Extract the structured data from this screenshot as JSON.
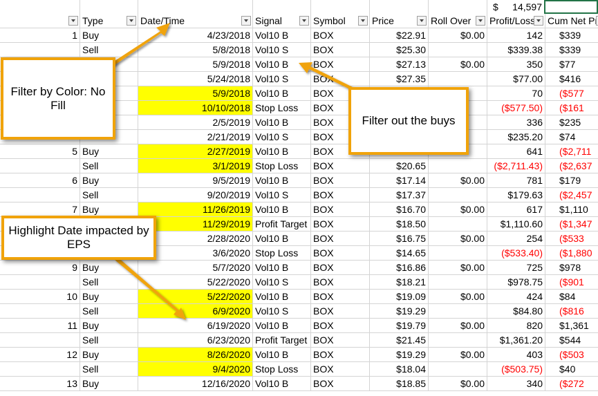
{
  "summary_cell": {
    "currency": "$",
    "value": "14,597"
  },
  "headers": [
    "Type",
    "Date/Time",
    "Signal",
    "Symbol",
    "Price",
    "Roll Over",
    "Profit/Loss",
    "Cum Net Pr"
  ],
  "rows": [
    {
      "num": "1",
      "type": "Buy",
      "date": "4/23/2018",
      "signal": "Vol10 B",
      "symbol": "BOX",
      "price": "$22.91",
      "roll": "$0.00",
      "pl": "142",
      "cum": "$339",
      "hl": false,
      "pl_neg": false,
      "cum_neg": false
    },
    {
      "num": "",
      "type": "Sell",
      "date": "5/8/2018",
      "signal": "Vol10 S",
      "symbol": "BOX",
      "price": "$25.30",
      "roll": "",
      "pl": "$339.38",
      "cum": "$339",
      "hl": false,
      "pl_neg": false,
      "cum_neg": false
    },
    {
      "num": "",
      "type": "",
      "date": "5/9/2018",
      "signal": "Vol10 B",
      "symbol": "BOX",
      "price": "$27.13",
      "roll": "$0.00",
      "pl": "350",
      "cum": "$77",
      "hl": false,
      "pl_neg": false,
      "cum_neg": false
    },
    {
      "num": "",
      "type": "",
      "date": "5/24/2018",
      "signal": "Vol10 S",
      "symbol": "BOX",
      "price": "$27.35",
      "roll": "",
      "pl": "$77.00",
      "cum": "$416",
      "hl": false,
      "pl_neg": false,
      "cum_neg": false
    },
    {
      "num": "",
      "type": "",
      "date": "5/9/2018",
      "signal": "Vol10 B",
      "symbol": "BOX",
      "price": "",
      "roll": "",
      "pl": "70",
      "cum": "($577",
      "hl": true,
      "pl_neg": false,
      "cum_neg": true
    },
    {
      "num": "",
      "type": "",
      "date": "10/10/2018",
      "signal": "Stop Loss",
      "symbol": "BOX",
      "price": "",
      "roll": "",
      "pl": "($577.50)",
      "cum": "($161",
      "hl": true,
      "pl_neg": true,
      "cum_neg": true
    },
    {
      "num": "",
      "type": "",
      "date": "2/5/2019",
      "signal": "Vol10 B",
      "symbol": "BOX",
      "price": "",
      "roll": "",
      "pl": "336",
      "cum": "$235",
      "hl": false,
      "pl_neg": false,
      "cum_neg": false
    },
    {
      "num": "",
      "type": "",
      "date": "2/21/2019",
      "signal": "Vol10 S",
      "symbol": "BOX",
      "price": "",
      "roll": "",
      "pl": "$235.20",
      "cum": "$74",
      "hl": false,
      "pl_neg": false,
      "cum_neg": false
    },
    {
      "num": "5",
      "type": "Buy",
      "date": "2/27/2019",
      "signal": "Vol10 B",
      "symbol": "BOX",
      "price": "",
      "roll": "",
      "pl": "641",
      "cum": "($2,711",
      "hl": true,
      "pl_neg": false,
      "cum_neg": true
    },
    {
      "num": "",
      "type": "Sell",
      "date": "3/1/2019",
      "signal": "Stop Loss",
      "symbol": "BOX",
      "price": "$20.65",
      "roll": "",
      "pl": "($2,711.43)",
      "cum": "($2,637",
      "hl": true,
      "pl_neg": true,
      "cum_neg": true
    },
    {
      "num": "6",
      "type": "Buy",
      "date": "9/5/2019",
      "signal": "Vol10 B",
      "symbol": "BOX",
      "price": "$17.14",
      "roll": "$0.00",
      "pl": "781",
      "cum": "$179",
      "hl": false,
      "pl_neg": false,
      "cum_neg": false
    },
    {
      "num": "",
      "type": "Sell",
      "date": "9/20/2019",
      "signal": "Vol10 S",
      "symbol": "BOX",
      "price": "$17.37",
      "roll": "",
      "pl": "$179.63",
      "cum": "($2,457",
      "hl": false,
      "pl_neg": false,
      "cum_neg": true
    },
    {
      "num": "7",
      "type": "Buy",
      "date": "11/26/2019",
      "signal": "Vol10 B",
      "symbol": "BOX",
      "price": "$16.70",
      "roll": "$0.00",
      "pl": "617",
      "cum": "$1,110",
      "hl": true,
      "pl_neg": false,
      "cum_neg": false
    },
    {
      "num": "",
      "type": "",
      "date": "11/29/2019",
      "signal": "Profit Target",
      "symbol": "BOX",
      "price": "$18.50",
      "roll": "",
      "pl": "$1,110.60",
      "cum": "($1,347",
      "hl": true,
      "pl_neg": false,
      "cum_neg": true
    },
    {
      "num": "",
      "type": "",
      "date": "2/28/2020",
      "signal": "Vol10 B",
      "symbol": "BOX",
      "price": "$16.75",
      "roll": "$0.00",
      "pl": "254",
      "cum": "($533",
      "hl": false,
      "pl_neg": false,
      "cum_neg": true
    },
    {
      "num": "",
      "type": "",
      "date": "3/6/2020",
      "signal": "Stop Loss",
      "symbol": "BOX",
      "price": "$14.65",
      "roll": "",
      "pl": "($533.40)",
      "cum": "($1,880",
      "hl": false,
      "pl_neg": true,
      "cum_neg": true
    },
    {
      "num": "9",
      "type": "Buy",
      "date": "5/7/2020",
      "signal": "Vol10 B",
      "symbol": "BOX",
      "price": "$16.86",
      "roll": "$0.00",
      "pl": "725",
      "cum": "$978",
      "hl": false,
      "pl_neg": false,
      "cum_neg": false
    },
    {
      "num": "",
      "type": "Sell",
      "date": "5/22/2020",
      "signal": "Vol10 S",
      "symbol": "BOX",
      "price": "$18.21",
      "roll": "",
      "pl": "$978.75",
      "cum": "($901",
      "hl": false,
      "pl_neg": false,
      "cum_neg": true
    },
    {
      "num": "10",
      "type": "Buy",
      "date": "5/22/2020",
      "signal": "Vol10 B",
      "symbol": "BOX",
      "price": "$19.09",
      "roll": "$0.00",
      "pl": "424",
      "cum": "$84",
      "hl": true,
      "pl_neg": false,
      "cum_neg": false
    },
    {
      "num": "",
      "type": "Sell",
      "date": "6/9/2020",
      "signal": "Vol10 S",
      "symbol": "BOX",
      "price": "$19.29",
      "roll": "",
      "pl": "$84.80",
      "cum": "($816",
      "hl": true,
      "pl_neg": false,
      "cum_neg": true
    },
    {
      "num": "11",
      "type": "Buy",
      "date": "6/19/2020",
      "signal": "Vol10 B",
      "symbol": "BOX",
      "price": "$19.79",
      "roll": "$0.00",
      "pl": "820",
      "cum": "$1,361",
      "hl": false,
      "pl_neg": false,
      "cum_neg": false
    },
    {
      "num": "",
      "type": "Sell",
      "date": "6/23/2020",
      "signal": "Profit Target",
      "symbol": "BOX",
      "price": "$21.45",
      "roll": "",
      "pl": "$1,361.20",
      "cum": "$544",
      "hl": false,
      "pl_neg": false,
      "cum_neg": false
    },
    {
      "num": "12",
      "type": "Buy",
      "date": "8/26/2020",
      "signal": "Vol10 B",
      "symbol": "BOX",
      "price": "$19.29",
      "roll": "$0.00",
      "pl": "403",
      "cum": "($503",
      "hl": true,
      "pl_neg": false,
      "cum_neg": true
    },
    {
      "num": "",
      "type": "Sell",
      "date": "9/4/2020",
      "signal": "Stop Loss",
      "symbol": "BOX",
      "price": "$18.04",
      "roll": "",
      "pl": "($503.75)",
      "cum": "$40",
      "hl": true,
      "pl_neg": true,
      "cum_neg": false
    },
    {
      "num": "13",
      "type": "Buy",
      "date": "12/16/2020",
      "signal": "Vol10 B",
      "symbol": "BOX",
      "price": "$18.85",
      "roll": "$0.00",
      "pl": "340",
      "cum": "($272",
      "hl": false,
      "pl_neg": false,
      "cum_neg": true
    }
  ],
  "callouts": {
    "filter_color": "Filter by Color: No Fill",
    "filter_buys": "Filter out the buys",
    "highlight_date": "Highlight Date impacted by EPS"
  },
  "colors": {
    "highlight": "#ffff00",
    "negative": "#ff0000",
    "callout_border": "#f0a30a",
    "selected_cell": "#217346"
  }
}
